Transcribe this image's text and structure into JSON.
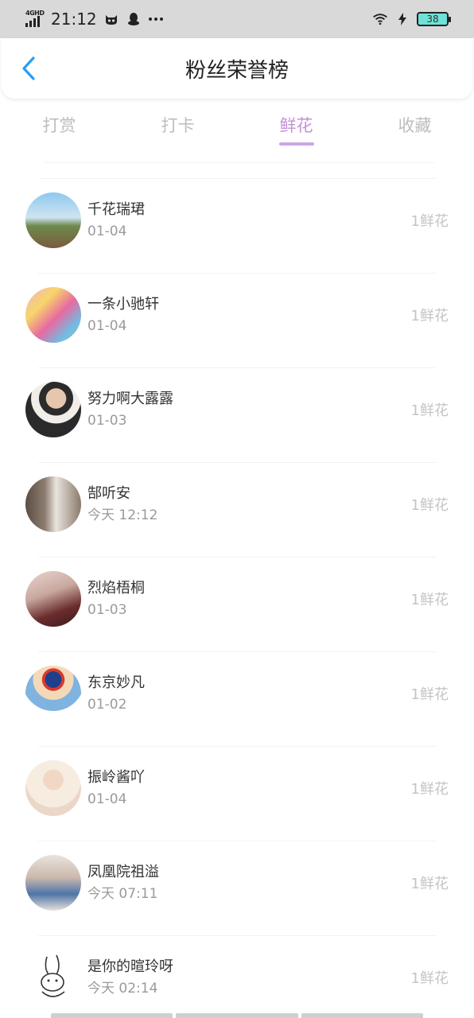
{
  "status_bar": {
    "network": "4GHD",
    "time": "21:12",
    "battery": "38"
  },
  "header": {
    "title": "粉丝荣誉榜"
  },
  "tabs": [
    {
      "label": "打赏",
      "active": false
    },
    {
      "label": "打卡",
      "active": false
    },
    {
      "label": "鲜花",
      "active": true
    },
    {
      "label": "收藏",
      "active": false
    }
  ],
  "list": [
    {
      "name": "千花瑞珺",
      "date": "01-04",
      "amount": "1鲜花"
    },
    {
      "name": "一条小驰轩",
      "date": "01-04",
      "amount": "1鲜花"
    },
    {
      "name": "努力啊大露露",
      "date": "01-03",
      "amount": "1鲜花"
    },
    {
      "name": "郜听安",
      "date": "今天 12:12",
      "amount": "1鲜花"
    },
    {
      "name": "烈焰梧桐",
      "date": "01-03",
      "amount": "1鲜花"
    },
    {
      "name": "东京妙凡",
      "date": "01-02",
      "amount": "1鲜花"
    },
    {
      "name": "振岭酱吖",
      "date": "01-04",
      "amount": "1鲜花"
    },
    {
      "name": "凤凰院祖溢",
      "date": "今天 07:11",
      "amount": "1鲜花"
    },
    {
      "name": "是你的暄玲呀",
      "date": "今天 02:14",
      "amount": "1鲜花"
    }
  ],
  "colors": {
    "accent": "#c591d9",
    "back_icon": "#2a9df4",
    "status_bar_bg": "#d9d9d9"
  },
  "icons": [
    "signal-icon",
    "cat-face-icon",
    "qq-penguin-icon",
    "more-dots-icon",
    "wifi-icon",
    "charging-icon",
    "battery-icon",
    "back-arrow-icon"
  ]
}
